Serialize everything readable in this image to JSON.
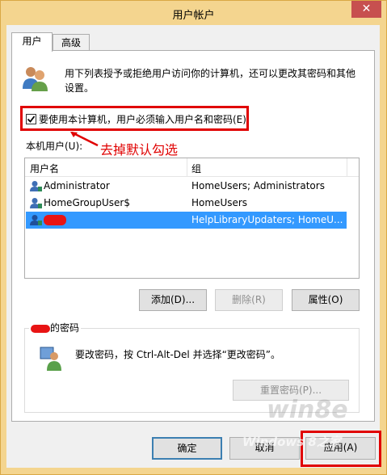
{
  "window": {
    "title": "用户帐户",
    "close_glyph": "✕"
  },
  "tabs": [
    {
      "label": "用户"
    },
    {
      "label": "高级"
    }
  ],
  "intro": {
    "text_line1": "用下列表授予或拒绝用户访问你的计算机，还可以更改其密码和其他",
    "text_line2": "设置。"
  },
  "require_login": {
    "label": "要使用本计算机，用户必须输入用户名和密码(E)",
    "checked": true
  },
  "annotation": {
    "text": "去掉默认勾选"
  },
  "users_section": {
    "label": "本机用户(U):"
  },
  "table": {
    "columns": [
      "用户名",
      "组"
    ],
    "rows": [
      {
        "name": "Administrator",
        "group": "HomeUsers; Administrators",
        "selected": false
      },
      {
        "name": "HomeGroupUser$",
        "group": "HomeUsers",
        "selected": false
      },
      {
        "name": "",
        "group": "HelpLibraryUpdaters; HomeU...",
        "selected": true
      }
    ]
  },
  "buttons": {
    "add": "添加(D)...",
    "remove": "删除(R)",
    "properties": "属性(O)",
    "reset_password": "重置密码(P)...",
    "ok": "确定",
    "cancel": "取消",
    "apply": "应用(A)"
  },
  "password_group": {
    "title_suffix": "的密码",
    "text": "要改密码，按 Ctrl-Alt-Del 并选择“更改密码”。"
  },
  "watermark": {
    "line1": "win8e",
    "line2": "Windows 8之家"
  },
  "colors": {
    "highlight": "#3399ff",
    "annotation_red": "#e00000",
    "title_bar": "#f4d58f"
  }
}
